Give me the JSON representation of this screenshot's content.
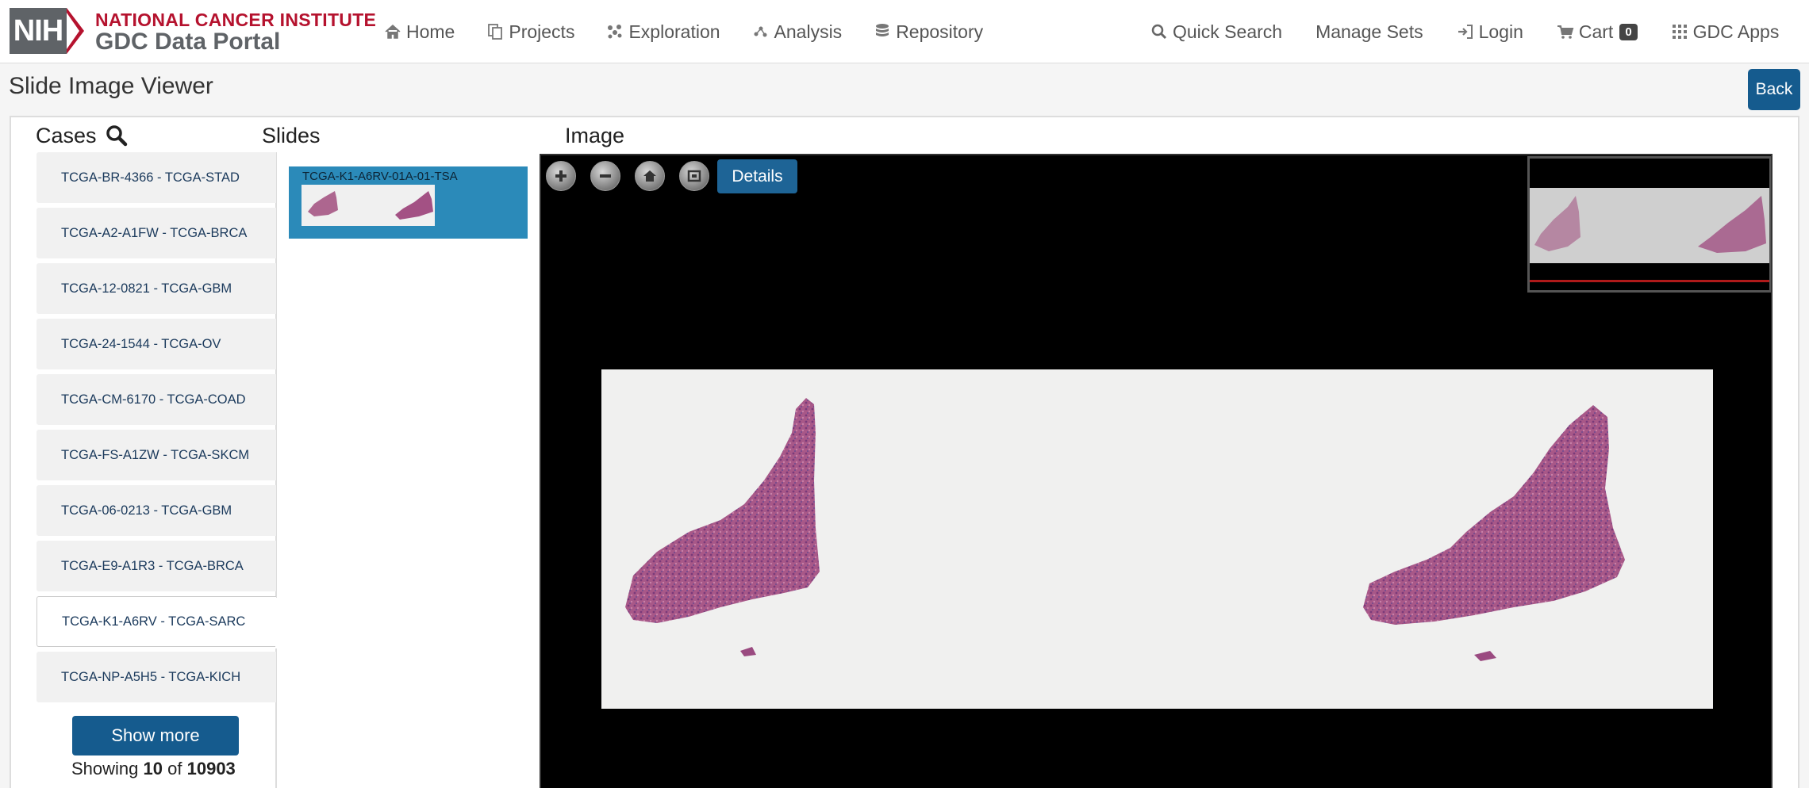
{
  "header": {
    "nih_logo": "NIH",
    "institute": "NATIONAL CANCER INSTITUTE",
    "portal": "GDC Data Portal",
    "nav_left": [
      {
        "label": "Home",
        "icon": "home-icon"
      },
      {
        "label": "Projects",
        "icon": "copy-icon"
      },
      {
        "label": "Exploration",
        "icon": "nodes-icon"
      },
      {
        "label": "Analysis",
        "icon": "analysis-icon"
      },
      {
        "label": "Repository",
        "icon": "database-icon"
      }
    ],
    "nav_right": [
      {
        "label": "Quick Search",
        "icon": "search-icon"
      },
      {
        "label": "Manage Sets",
        "icon": ""
      },
      {
        "label": "Login",
        "icon": "login-icon"
      },
      {
        "label": "Cart",
        "icon": "cart-icon",
        "badge": "0"
      },
      {
        "label": "GDC Apps",
        "icon": "grid-icon"
      }
    ]
  },
  "page": {
    "title": "Slide Image Viewer",
    "back_label": "Back"
  },
  "columns": {
    "cases": "Cases",
    "slides": "Slides",
    "image": "Image"
  },
  "cases": {
    "items": [
      {
        "label": "TCGA-BR-4366 - TCGA-STAD",
        "active": false
      },
      {
        "label": "TCGA-A2-A1FW - TCGA-BRCA",
        "active": false
      },
      {
        "label": "TCGA-12-0821 - TCGA-GBM",
        "active": false
      },
      {
        "label": "TCGA-24-1544 - TCGA-OV",
        "active": false
      },
      {
        "label": "TCGA-CM-6170 - TCGA-COAD",
        "active": false
      },
      {
        "label": "TCGA-FS-A1ZW - TCGA-SKCM",
        "active": false
      },
      {
        "label": "TCGA-06-0213 - TCGA-GBM",
        "active": false
      },
      {
        "label": "TCGA-E9-A1R3 - TCGA-BRCA",
        "active": false
      },
      {
        "label": "TCGA-K1-A6RV - TCGA-SARC",
        "active": true
      },
      {
        "label": "TCGA-NP-A5H5 - TCGA-KICH",
        "active": false
      }
    ],
    "show_more": "Show more",
    "showing_prefix": "Showing",
    "showing_count": "10",
    "showing_of": "of",
    "showing_total": "10903"
  },
  "slides": {
    "items": [
      {
        "label": "TCGA-K1-A6RV-01A-01-TSA"
      }
    ]
  },
  "viewer": {
    "controls": [
      "zoom-in-icon",
      "zoom-out-icon",
      "home-icon",
      "fullscreen-icon"
    ],
    "details_label": "Details"
  },
  "colors": {
    "brand_red": "#b5122e",
    "primary_blue": "#155b8e",
    "slide_selected": "#2b8ab9",
    "tissue": "#a14d7e"
  }
}
